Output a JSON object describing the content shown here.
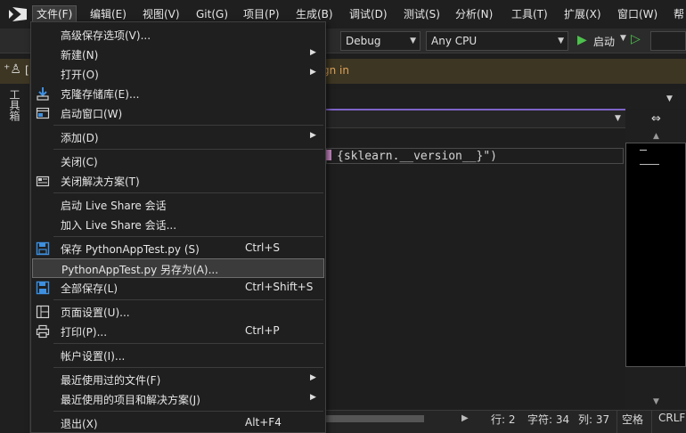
{
  "menubar": {
    "items": [
      {
        "label": "文件(F)",
        "active": true
      },
      {
        "label": "编辑(E)"
      },
      {
        "label": "视图(V)"
      },
      {
        "label": "Git(G)"
      },
      {
        "label": "项目(P)"
      },
      {
        "label": "生成(B)"
      },
      {
        "label": "调试(D)"
      },
      {
        "label": "测试(S)"
      },
      {
        "label": "分析(N)"
      },
      {
        "label": "工具(T)"
      },
      {
        "label": "扩展(X)"
      },
      {
        "label": "窗口(W)"
      },
      {
        "label": "帮"
      }
    ]
  },
  "toolbar": {
    "config": "Debug",
    "platform": "Any CPU",
    "start_label": "启动"
  },
  "infobar": {
    "bracket": "[",
    "signin_fragment": "gn in"
  },
  "sidebar": {
    "toolbox_label": "工具箱"
  },
  "editor": {
    "code": "{sklearn.__version__}\")"
  },
  "statusbar": {
    "line": "行: 2",
    "char": "字符: 34",
    "col": "列: 37",
    "space": "空格",
    "eol": "CRLF"
  },
  "file_menu": {
    "items": [
      {
        "label": "高级保存选项(V)..."
      },
      {
        "label": "新建(N)",
        "submenu": true
      },
      {
        "label": "打开(O)",
        "submenu": true
      },
      {
        "label": "克隆存储库(E)...",
        "icon": "clone-icon"
      },
      {
        "label": "启动窗口(W)",
        "icon": "start-window-icon"
      },
      {
        "label": "添加(D)",
        "submenu": true
      },
      {
        "label": "关闭(C)"
      },
      {
        "label": "关闭解决方案(T)",
        "icon": "close-solution-icon"
      },
      {
        "label": "启动 Live Share 会话"
      },
      {
        "label": "加入 Live Share 会话..."
      },
      {
        "label": "保存 PythonAppTest.py (S)",
        "shortcut": "Ctrl+S",
        "icon": "save-icon"
      },
      {
        "label": "PythonAppTest.py 另存为(A)...",
        "highlighted": true
      },
      {
        "label": "全部保存(L)",
        "shortcut": "Ctrl+Shift+S",
        "icon": "save-all-icon"
      },
      {
        "label": "页面设置(U)...",
        "icon": "page-setup-icon"
      },
      {
        "label": "打印(P)...",
        "shortcut": "Ctrl+P",
        "icon": "print-icon"
      },
      {
        "label": "帐户设置(I)..."
      },
      {
        "label": "最近使用过的文件(F)",
        "submenu": true
      },
      {
        "label": "最近使用的项目和解决方案(J)",
        "submenu": true
      },
      {
        "label": "退出(X)",
        "shortcut": "Alt+F4"
      }
    ]
  },
  "colors": {
    "accent": "#7f64c8",
    "play": "#4cc24c",
    "signin": "#e0a458",
    "save_icon": "#3d8fe0"
  }
}
